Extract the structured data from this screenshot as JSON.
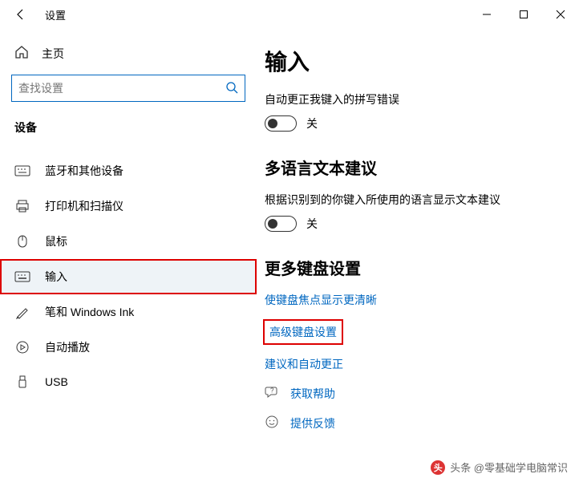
{
  "titlebar": {
    "title": "设置"
  },
  "sidebar": {
    "home": "主页",
    "search_placeholder": "查找设置",
    "section": "设备",
    "items": [
      {
        "id": "bluetooth",
        "label": "蓝牙和其他设备"
      },
      {
        "id": "printers",
        "label": "打印机和扫描仪"
      },
      {
        "id": "mouse",
        "label": "鼠标"
      },
      {
        "id": "typing",
        "label": "输入"
      },
      {
        "id": "pen",
        "label": "笔和 Windows Ink"
      },
      {
        "id": "autoplay",
        "label": "自动播放"
      },
      {
        "id": "usb",
        "label": "USB"
      }
    ]
  },
  "main": {
    "heading": "输入",
    "spelling_label": "自动更正我键入的拼写错误",
    "spelling_state": "关",
    "multilang_heading": "多语言文本建议",
    "multilang_desc": "根据识别到的你键入所使用的语言显示文本建议",
    "multilang_state": "关",
    "more_heading": "更多键盘设置",
    "link_focus": "使键盘焦点显示更清晰",
    "link_advanced": "高级键盘设置",
    "link_suggest": "建议和自动更正",
    "help": "获取帮助",
    "feedback": "提供反馈"
  },
  "watermark": "头条 @零基础学电脑常识"
}
